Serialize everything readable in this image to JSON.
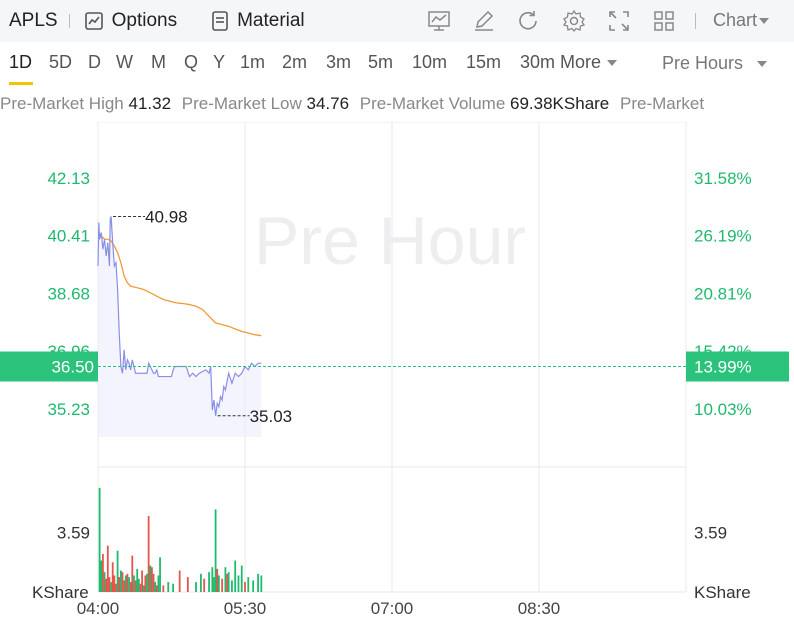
{
  "toolbar": {
    "ticker": "APLS",
    "options_label": "Options",
    "material_label": "Material",
    "chart_type_label": "Chart",
    "icons": [
      "indicator-icon",
      "draw-icon",
      "refresh-icon",
      "settings-icon",
      "fullscreen-icon",
      "layout-icon"
    ]
  },
  "periods": [
    "1D",
    "5D",
    "D",
    "W",
    "M",
    "Q",
    "Y",
    "1m",
    "2m",
    "3m",
    "5m",
    "10m",
    "15m",
    "30m"
  ],
  "active_period": "1D",
  "more_label": "More",
  "session_label": "Pre Hours",
  "stats": [
    {
      "label": "Pre-Market High",
      "value": "41.32"
    },
    {
      "label": "Pre-Market Low",
      "value": "34.76"
    },
    {
      "label": "Pre-Market Volume",
      "value": "69.38KShare"
    },
    {
      "label": "Pre-Market ",
      "value": ""
    }
  ],
  "colors": {
    "up": "#1fba6e",
    "down": "#e8534b",
    "price_line": "#8a8fe6",
    "avg_line": "#f29a38",
    "grid": "#e8e8ec",
    "current_badge": "#2bc27c"
  },
  "chart_data": {
    "type": "line",
    "watermark": "Pre Hour",
    "price_ticks": [
      "42.13",
      "40.41",
      "38.68",
      "36.96",
      "35.23"
    ],
    "percent_ticks": [
      "31.58%",
      "26.19%",
      "20.81%",
      "15.42%",
      "10.03%"
    ],
    "x_ticks": [
      "04:00",
      "05:30",
      "07:00",
      "08:30"
    ],
    "volume_tick": "3.59",
    "volume_unit": "KShare",
    "current_price": "36.50",
    "current_percent": "13.99%",
    "high_label": "40.98",
    "low_label": "35.03",
    "price_ylim": [
      33.5,
      43.8
    ],
    "volume_ylim": [
      0,
      7.2
    ],
    "x_minutes_range": [
      0,
      360
    ],
    "price": [
      [
        0,
        39.5
      ],
      [
        0.5,
        40.8
      ],
      [
        1,
        40.3
      ],
      [
        2,
        40.5
      ],
      [
        3,
        40.0
      ],
      [
        4,
        40.3
      ],
      [
        5,
        39.8
      ],
      [
        6,
        40.2
      ],
      [
        7,
        39.5
      ],
      [
        7.5,
        40.9
      ],
      [
        8,
        40.98
      ],
      [
        9,
        40.2
      ],
      [
        10,
        39.5
      ],
      [
        11,
        39.6
      ],
      [
        12,
        38.8
      ],
      [
        13,
        37.5
      ],
      [
        14,
        36.5
      ],
      [
        15,
        36.3
      ],
      [
        16,
        37.0
      ],
      [
        17,
        36.4
      ],
      [
        18,
        36.7
      ],
      [
        19,
        36.6
      ],
      [
        20,
        36.4
      ],
      [
        21,
        36.7
      ],
      [
        22,
        36.5
      ],
      [
        23,
        36.3
      ],
      [
        24,
        36.3
      ],
      [
        30,
        36.3
      ],
      [
        31,
        36.6
      ],
      [
        32,
        36.5
      ],
      [
        33,
        36.4
      ],
      [
        34,
        36.3
      ],
      [
        35,
        36.3
      ],
      [
        36,
        36.4
      ],
      [
        37,
        36.2
      ],
      [
        38,
        36.2
      ],
      [
        45,
        36.2
      ],
      [
        46,
        36.4
      ],
      [
        47,
        36.5
      ],
      [
        48,
        36.5
      ],
      [
        54,
        36.5
      ],
      [
        56,
        36.2
      ],
      [
        58,
        36.3
      ],
      [
        60,
        36.2
      ],
      [
        62,
        36.3
      ],
      [
        66,
        36.4
      ],
      [
        68,
        36.3
      ],
      [
        69,
        36.5
      ],
      [
        70,
        35.2
      ],
      [
        71,
        35.5
      ],
      [
        72,
        35.03
      ],
      [
        73,
        35.4
      ],
      [
        74,
        35.3
      ],
      [
        75,
        35.6
      ],
      [
        76,
        35.5
      ],
      [
        77,
        35.9
      ],
      [
        78,
        35.8
      ],
      [
        80,
        36.3
      ],
      [
        82,
        36.0
      ],
      [
        84,
        36.3
      ],
      [
        86,
        36.2
      ],
      [
        88,
        36.3
      ],
      [
        90,
        36.5
      ],
      [
        92,
        36.4
      ],
      [
        94,
        36.6
      ],
      [
        96,
        36.5
      ],
      [
        98,
        36.6
      ],
      [
        100,
        36.6
      ]
    ],
    "avg": [
      [
        0,
        40.5
      ],
      [
        2,
        40.4
      ],
      [
        4,
        40.3
      ],
      [
        6,
        40.3
      ],
      [
        8,
        40.25
      ],
      [
        10,
        40.1
      ],
      [
        12,
        39.9
      ],
      [
        14,
        39.6
      ],
      [
        16,
        39.2
      ],
      [
        18,
        39.0
      ],
      [
        20,
        38.9
      ],
      [
        24,
        38.85
      ],
      [
        28,
        38.8
      ],
      [
        32,
        38.7
      ],
      [
        36,
        38.6
      ],
      [
        40,
        38.5
      ],
      [
        44,
        38.45
      ],
      [
        48,
        38.4
      ],
      [
        52,
        38.38
      ],
      [
        56,
        38.35
      ],
      [
        60,
        38.3
      ],
      [
        64,
        38.2
      ],
      [
        68,
        38.0
      ],
      [
        72,
        37.8
      ],
      [
        76,
        37.75
      ],
      [
        80,
        37.7
      ],
      [
        84,
        37.62
      ],
      [
        88,
        37.55
      ],
      [
        92,
        37.5
      ],
      [
        96,
        37.45
      ],
      [
        100,
        37.42
      ]
    ],
    "volume": [
      {
        "t": 1,
        "v": 6.3,
        "dir": "up"
      },
      {
        "t": 2,
        "v": 1.9,
        "dir": "up"
      },
      {
        "t": 3,
        "v": 2.3,
        "dir": "down"
      },
      {
        "t": 4,
        "v": 1.2,
        "dir": "up"
      },
      {
        "t": 5,
        "v": 0.8,
        "dir": "down"
      },
      {
        "t": 6,
        "v": 2.8,
        "dir": "down"
      },
      {
        "t": 7,
        "v": 0.9,
        "dir": "down"
      },
      {
        "t": 8,
        "v": 0.6,
        "dir": "up"
      },
      {
        "t": 9,
        "v": 1.8,
        "dir": "down"
      },
      {
        "t": 10,
        "v": 1.0,
        "dir": "down"
      },
      {
        "t": 11,
        "v": 0.5,
        "dir": "down"
      },
      {
        "t": 12,
        "v": 2.5,
        "dir": "up"
      },
      {
        "t": 13,
        "v": 0.9,
        "dir": "down"
      },
      {
        "t": 14,
        "v": 1.3,
        "dir": "up"
      },
      {
        "t": 15,
        "v": 1.2,
        "dir": "down"
      },
      {
        "t": 16,
        "v": 0.7,
        "dir": "down"
      },
      {
        "t": 17,
        "v": 1.0,
        "dir": "up"
      },
      {
        "t": 18,
        "v": 1.1,
        "dir": "down"
      },
      {
        "t": 19,
        "v": 0.9,
        "dir": "up"
      },
      {
        "t": 20,
        "v": 0.6,
        "dir": "down"
      },
      {
        "t": 21,
        "v": 2.2,
        "dir": "down"
      },
      {
        "t": 22,
        "v": 1.0,
        "dir": "up"
      },
      {
        "t": 23,
        "v": 0.7,
        "dir": "down"
      },
      {
        "t": 24,
        "v": 1.4,
        "dir": "up"
      },
      {
        "t": 25,
        "v": 0.8,
        "dir": "up"
      },
      {
        "t": 26,
        "v": 0.5,
        "dir": "down"
      },
      {
        "t": 27,
        "v": 1.3,
        "dir": "down"
      },
      {
        "t": 28,
        "v": 0.4,
        "dir": "up"
      },
      {
        "t": 29,
        "v": 1.0,
        "dir": "down"
      },
      {
        "t": 30,
        "v": 1.1,
        "dir": "up"
      },
      {
        "t": 31,
        "v": 4.6,
        "dir": "down"
      },
      {
        "t": 32,
        "v": 1.6,
        "dir": "up"
      },
      {
        "t": 33,
        "v": 1.5,
        "dir": "down"
      },
      {
        "t": 34,
        "v": 1.1,
        "dir": "down"
      },
      {
        "t": 35,
        "v": 0.6,
        "dir": "up"
      },
      {
        "t": 36,
        "v": 0.4,
        "dir": "down"
      },
      {
        "t": 37,
        "v": 1.0,
        "dir": "up"
      },
      {
        "t": 38,
        "v": 2.1,
        "dir": "up"
      },
      {
        "t": 40,
        "v": 0.4,
        "dir": "down"
      },
      {
        "t": 43,
        "v": 0.6,
        "dir": "up"
      },
      {
        "t": 46,
        "v": 0.5,
        "dir": "up"
      },
      {
        "t": 50,
        "v": 1.3,
        "dir": "down"
      },
      {
        "t": 55,
        "v": 0.9,
        "dir": "down"
      },
      {
        "t": 60,
        "v": 0.6,
        "dir": "up"
      },
      {
        "t": 63,
        "v": 1.1,
        "dir": "up"
      },
      {
        "t": 65,
        "v": 0.8,
        "dir": "down"
      },
      {
        "t": 68,
        "v": 1.2,
        "dir": "up"
      },
      {
        "t": 70,
        "v": 1.5,
        "dir": "up"
      },
      {
        "t": 71,
        "v": 0.9,
        "dir": "up"
      },
      {
        "t": 72,
        "v": 5.0,
        "dir": "up"
      },
      {
        "t": 73,
        "v": 1.4,
        "dir": "down"
      },
      {
        "t": 74,
        "v": 1.0,
        "dir": "up"
      },
      {
        "t": 76,
        "v": 0.8,
        "dir": "down"
      },
      {
        "t": 78,
        "v": 1.5,
        "dir": "up"
      },
      {
        "t": 79,
        "v": 1.1,
        "dir": "down"
      },
      {
        "t": 80,
        "v": 1.2,
        "dir": "up"
      },
      {
        "t": 82,
        "v": 0.7,
        "dir": "up"
      },
      {
        "t": 84,
        "v": 1.9,
        "dir": "up"
      },
      {
        "t": 86,
        "v": 1.0,
        "dir": "up"
      },
      {
        "t": 88,
        "v": 1.6,
        "dir": "up"
      },
      {
        "t": 90,
        "v": 0.6,
        "dir": "down"
      },
      {
        "t": 92,
        "v": 0.9,
        "dir": "up"
      },
      {
        "t": 95,
        "v": 0.7,
        "dir": "up"
      },
      {
        "t": 98,
        "v": 1.1,
        "dir": "up"
      },
      {
        "t": 100,
        "v": 1.0,
        "dir": "up"
      }
    ]
  }
}
